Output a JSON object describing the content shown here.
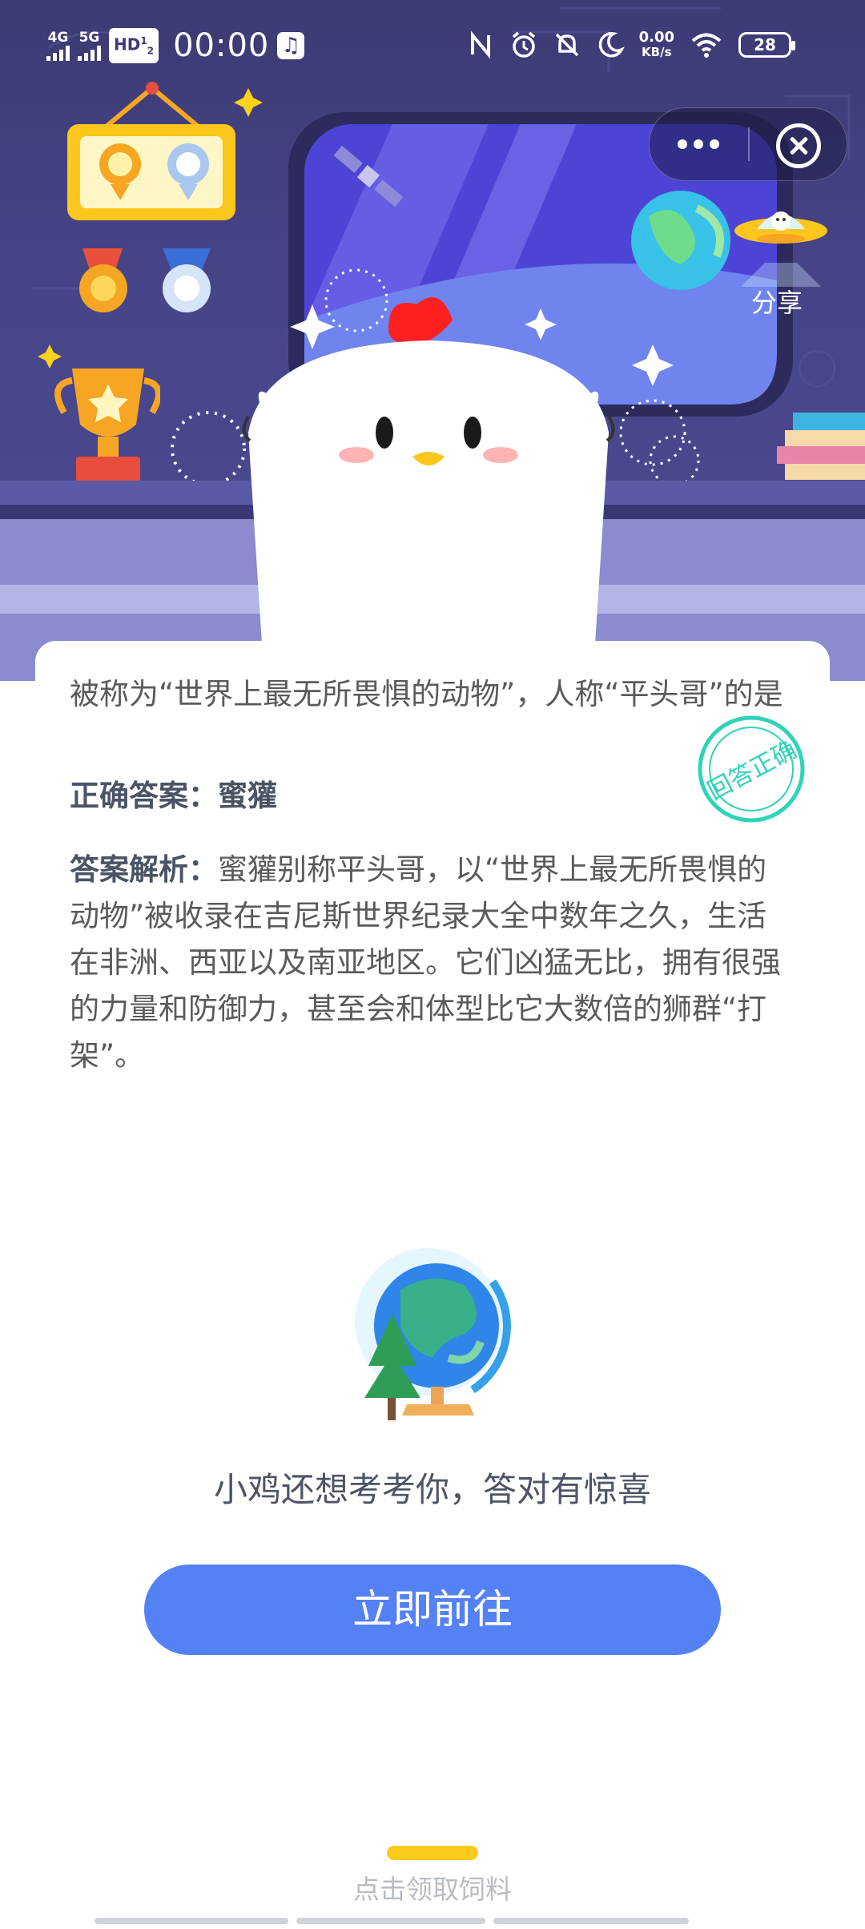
{
  "status_bar": {
    "net1": "4G",
    "net2": "5G",
    "hd": "HD",
    "hd_sup": "1",
    "hd_sub": "2",
    "time": "00:00",
    "speed_value": "0.00",
    "speed_unit": "KB/s",
    "battery": "28"
  },
  "capsule": {
    "more_icon": "more-dots-icon",
    "close_icon": "close-circle-icon"
  },
  "share": {
    "label": "分享"
  },
  "question": {
    "text": "被称为“世界上最无所畏惧的动物”，人称“平头哥”的是"
  },
  "answer": {
    "label": "正确答案：",
    "value": "蜜獾"
  },
  "analysis": {
    "label": "答案解析：",
    "text": "蜜獾别称平头哥，以“世界上最无所畏惧的动物”被收录在吉尼斯世界纪录大全中数年之久，生活在非洲、西亚以及南亚地区。它们凶猛无比，拥有很强的力量和防御力，甚至会和体型比它大数倍的狮群“打架”。"
  },
  "stamp": {
    "text": "回答正确"
  },
  "promo": {
    "tease": "小鸡还想考考你，答对有惊喜",
    "button_label": "立即前往"
  },
  "footer": {
    "feed_label": "点击领取饲料"
  },
  "colors": {
    "accent": "#5481f6",
    "scene_bg": "#3d3b73",
    "feed_bar": "#fcca1a",
    "stamp": "#2fd3b8"
  }
}
